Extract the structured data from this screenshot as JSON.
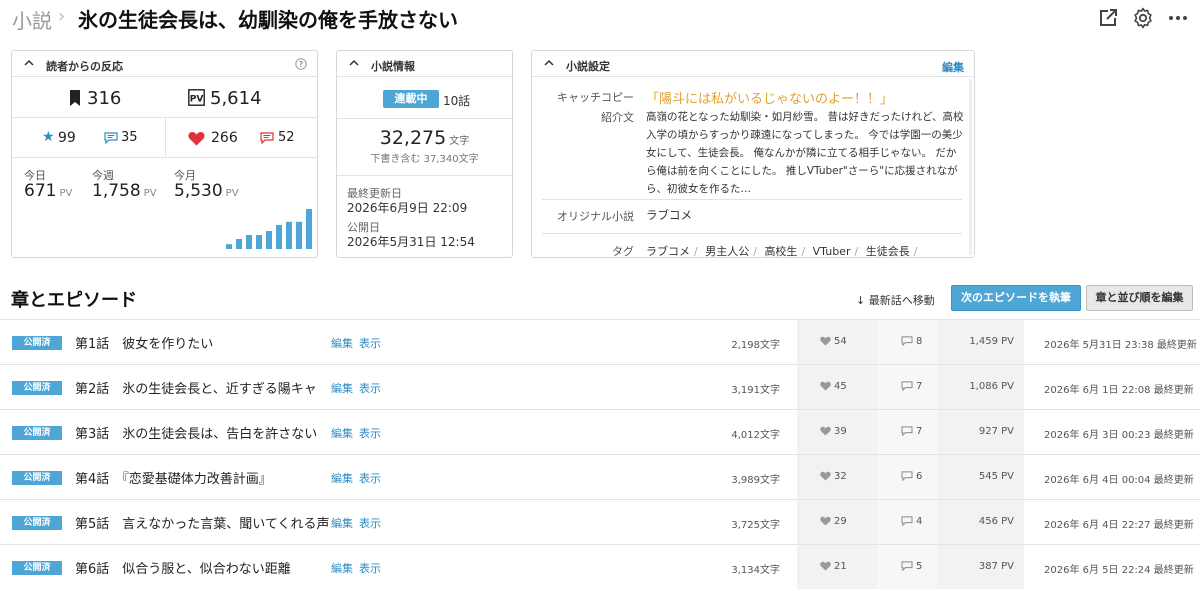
{
  "header": {
    "breadcrumb": "小説",
    "title": "氷の生徒会長は、幼馴染の俺を手放さない"
  },
  "reactions": {
    "heading": "読者からの反応",
    "bookmarks": "316",
    "pv_total": "5,614",
    "stars": "99",
    "reviews": "35",
    "hearts": "266",
    "comments": "52",
    "pv_today_label": "今日",
    "pv_today": "671",
    "pv_week_label": "今週",
    "pv_week": "1,758",
    "pv_month_label": "今月",
    "pv_month": "5,530",
    "pv_unit": "PV",
    "daily_pv_levels": [
      0.12,
      0.25,
      0.35,
      0.35,
      0.45,
      0.6,
      0.68,
      0.68,
      1.0,
      0.78
    ]
  },
  "info": {
    "heading": "小説情報",
    "status": "連載中",
    "episodes": "10話",
    "chars": "32,275",
    "chars_unit": "文字",
    "draft_note": "下書き含む 37,340文字",
    "last_updated_label": "最終更新日",
    "last_updated": "2026年6月9日 22:09",
    "published_label": "公開日",
    "published": "2026年5月31日 12:54"
  },
  "settings": {
    "heading": "小説設定",
    "edit": "編集",
    "catchcopy_label": "キャッチコピー",
    "catchcopy": "「陽斗には私がいるじゃないのよー！！」",
    "intro_label": "紹介文",
    "intro": "高嶺の花となった幼馴染・如月紗雪。 昔は好きだったけれど、高校入学の頃からすっかり疎遠になってしまった。 今では学園一の美少女にして、生徒会長。 俺なんかが隣に立てる相手じゃない。 だから俺は前を向くことにした。 推しVTuber\"さーら\"に応援されながら、初彼女を作るた…",
    "original_label": "オリジナル小説",
    "original": "ラブコメ",
    "tags_label": "タグ",
    "tags": [
      "ラブコメ",
      "男主人公",
      "高校生",
      "VTuber",
      "生徒会長"
    ]
  },
  "episodes_section": {
    "title": "章とエピソード",
    "jump_latest": "↓ 最新話へ移動",
    "write_next": "次のエピソードを執筆",
    "reorder": "章と並び順を編集",
    "edit_label": "編集",
    "view_label": "表示",
    "rows": [
      {
        "status": "公開済",
        "title": "第1話　彼女を作りたい",
        "words": "2,198文字",
        "likes": "54",
        "comments": "8",
        "pv": "1,459 PV",
        "updated": "2026年  5月31日 23:38 最終更新"
      },
      {
        "status": "公開済",
        "title": "第2話　氷の生徒会長と、近すぎる陽キャ",
        "words": "3,191文字",
        "likes": "45",
        "comments": "7",
        "pv": "1,086 PV",
        "updated": "2026年  6月  1日 22:08 最終更新"
      },
      {
        "status": "公開済",
        "title": "第3話　氷の生徒会長は、告白を許さない",
        "words": "4,012文字",
        "likes": "39",
        "comments": "7",
        "pv": "927 PV",
        "updated": "2026年  6月  3日 00:23 最終更新"
      },
      {
        "status": "公開済",
        "title": "第4話　『恋愛基礎体力改善計画』",
        "words": "3,989文字",
        "likes": "32",
        "comments": "6",
        "pv": "545 PV",
        "updated": "2026年  6月  4日 00:04 最終更新"
      },
      {
        "status": "公開済",
        "title": "第5話　言えなかった言葉、聞いてくれる声",
        "words": "3,725文字",
        "likes": "29",
        "comments": "4",
        "pv": "456 PV",
        "updated": "2026年  6月  4日 22:27 最終更新"
      },
      {
        "status": "公開済",
        "title": "第6話　似合う服と、似合わない距離",
        "words": "3,134文字",
        "likes": "21",
        "comments": "5",
        "pv": "387 PV",
        "updated": "2026年  6月  5日 22:24 最終更新"
      }
    ]
  },
  "colors": {
    "accent": "#4ea6d6",
    "link": "#2d8cc4",
    "catchcopy": "#e2a131",
    "heart": "#e0313b",
    "star": "#2d8cc4"
  }
}
